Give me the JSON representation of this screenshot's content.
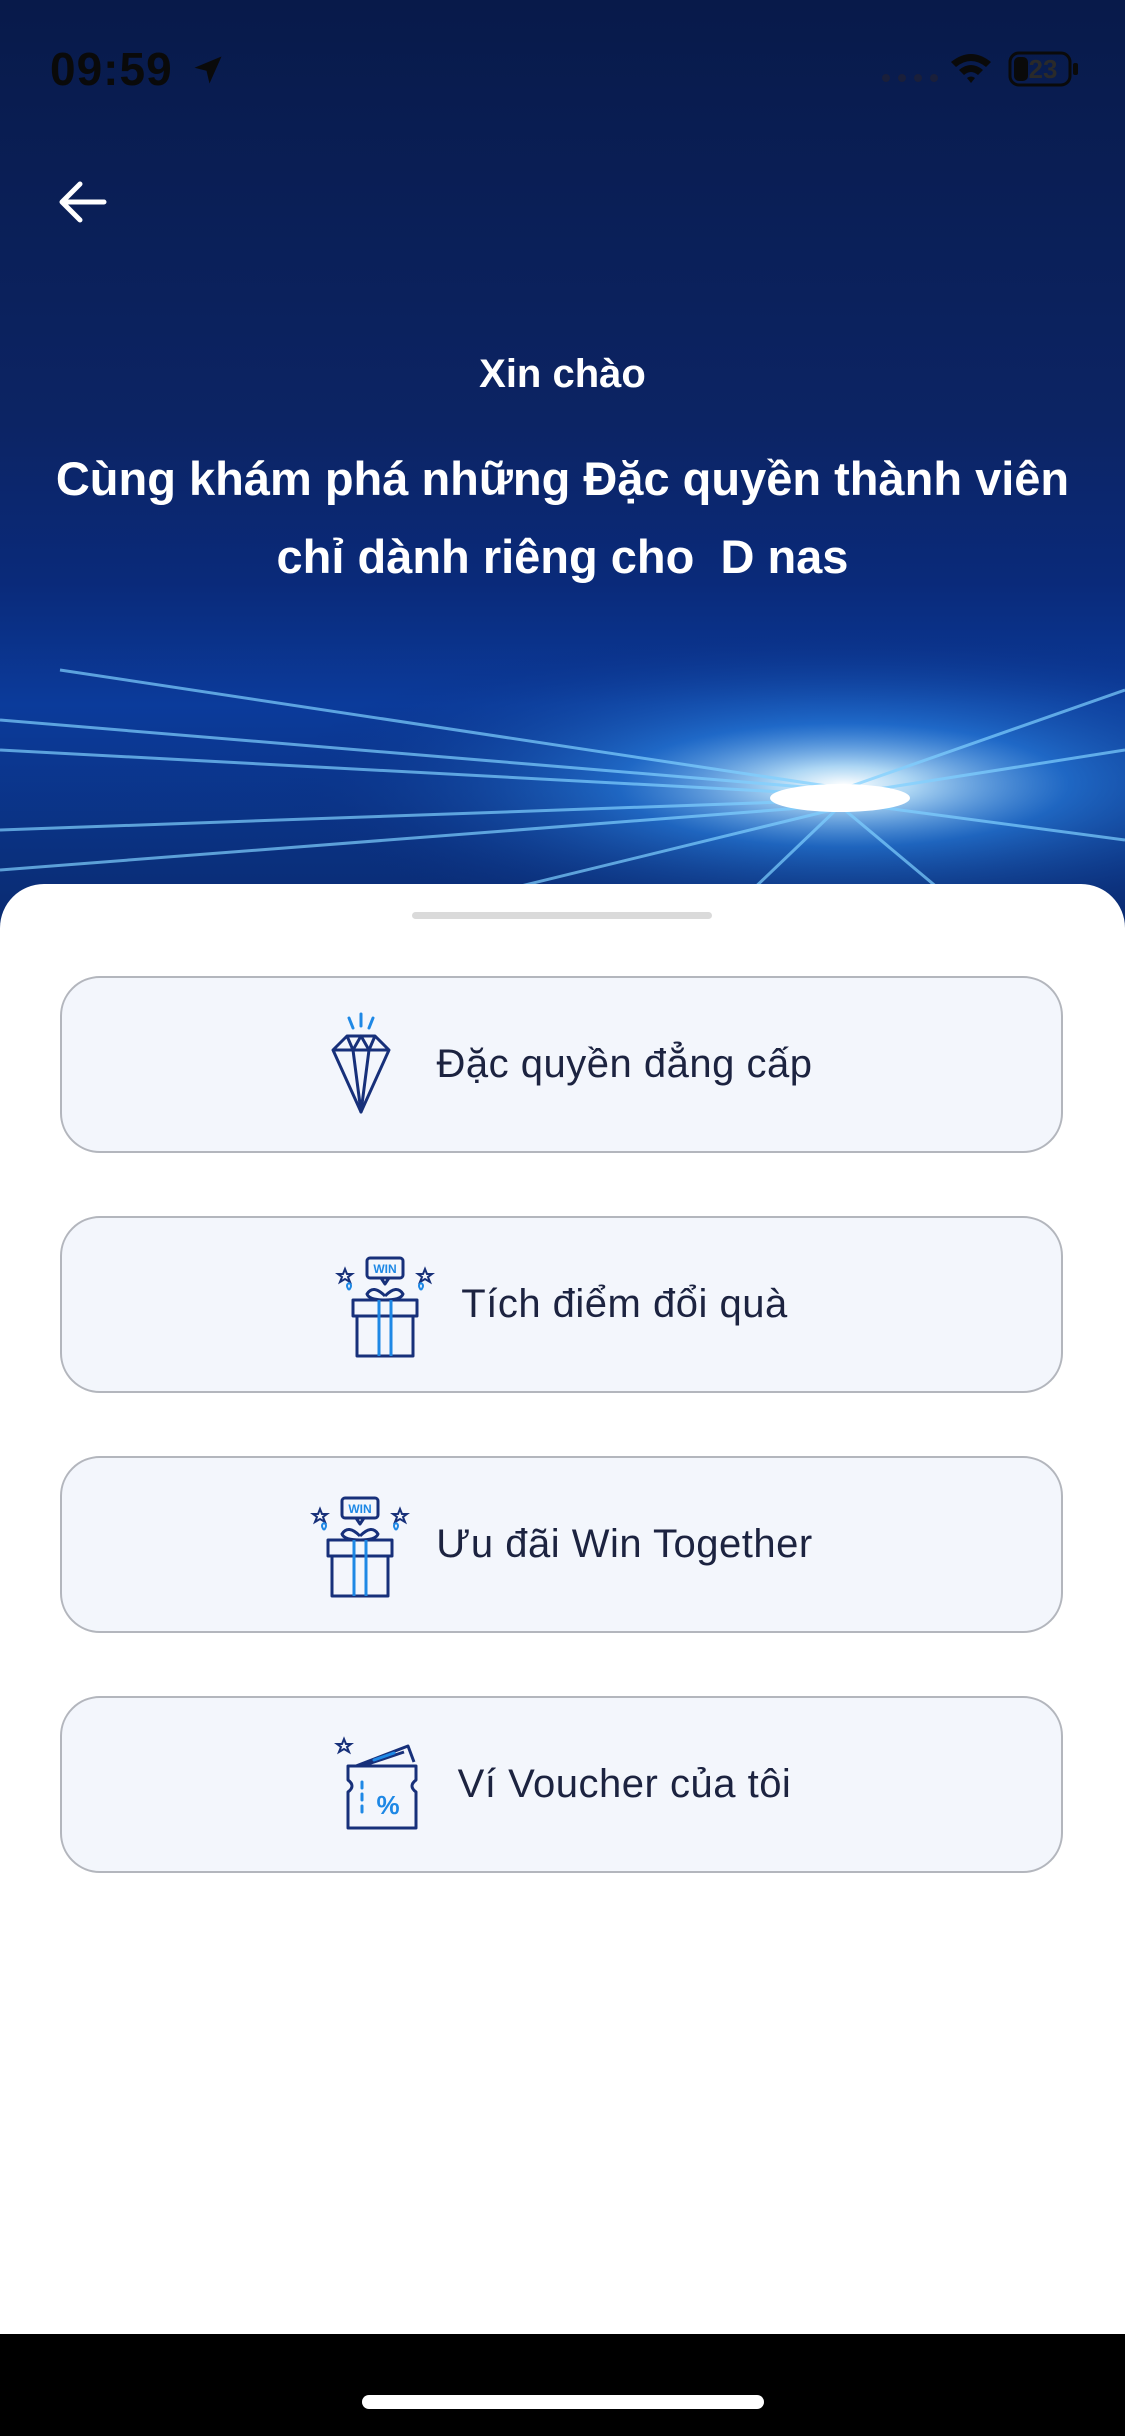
{
  "status_bar": {
    "time": "09:59",
    "battery": "23"
  },
  "header": {
    "greeting": "Xin chào",
    "headline_line1": "Cùng khám phá những Đặc quyền thành viên",
    "headline_line2": "chỉ dành riêng cho  D nas"
  },
  "menu": {
    "items": [
      {
        "label": "Đặc quyền đẳng cấp",
        "icon": "diamond-icon"
      },
      {
        "label": "Tích điểm đổi quà",
        "icon": "gift-win-icon"
      },
      {
        "label": "Ưu đãi Win Together",
        "icon": "gift-win-icon"
      },
      {
        "label": "Ví Voucher của tôi",
        "icon": "voucher-icon"
      }
    ]
  },
  "icon_text": {
    "win": "WIN",
    "percent": "%"
  },
  "colors": {
    "hero_dark": "#081a4a",
    "hero_light": "#0b3b9b",
    "accent_blue": "#1e88e5",
    "icon_navy": "#17307a",
    "card_bg": "#f3f6fc",
    "card_border": "#b3b6bd",
    "text_dark": "#1c2340"
  }
}
